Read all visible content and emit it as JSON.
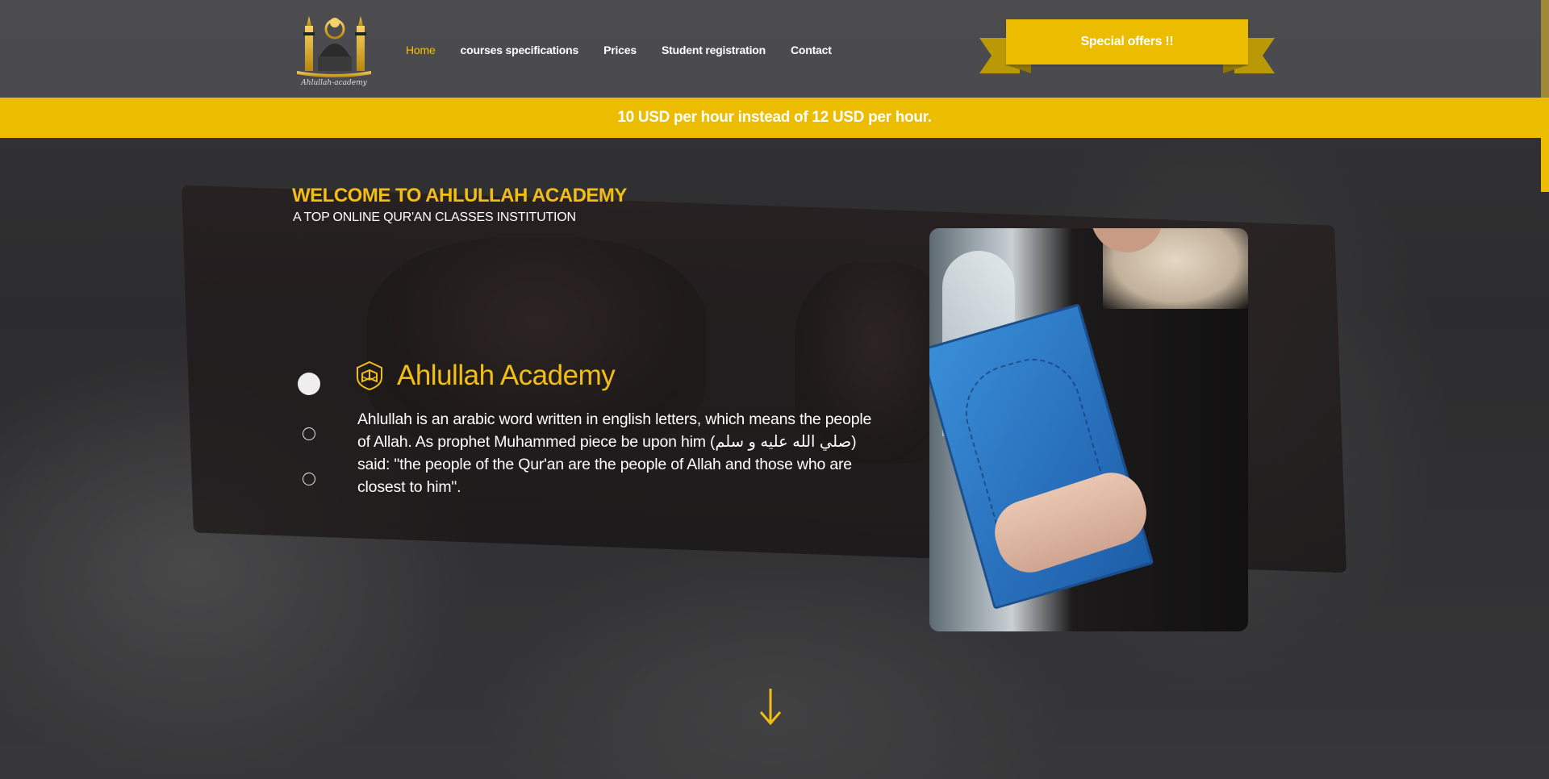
{
  "logo": {
    "caption": "Ahlullah-academy"
  },
  "nav": {
    "items": [
      {
        "label": "Home",
        "active": true
      },
      {
        "label": "courses specifications",
        "active": false
      },
      {
        "label": "Prices",
        "active": false
      },
      {
        "label": "Student registration",
        "active": false
      },
      {
        "label": "Contact",
        "active": false
      }
    ]
  },
  "special_offer": {
    "label": "Special offers !!"
  },
  "promo": {
    "text": "10 USD per hour instead of 12 USD per hour."
  },
  "hero": {
    "welcome": "WELCOME TO AHLULLAH ACADEMY",
    "subtitle": "A TOP ONLINE QUR'AN CLASSES INSTITUTION"
  },
  "slider": {
    "active_index": 0,
    "count": 3,
    "title": "Ahlullah Academy",
    "text": "Ahlullah is an arabic word written in english letters, which means the people of Allah. As prophet Muhammed piece be upon him (صلي الله عليه و سلم) said: \"the people of the Qur'an are the people of Allah and those who are closest to him\"."
  },
  "icons": {
    "slide_icon": "book-shield-icon",
    "scroll_down": "arrow-down-icon"
  },
  "colors": {
    "accent": "#ecbc00",
    "accent_text": "#f2be15",
    "ribbon_dark": "#b99a06"
  }
}
